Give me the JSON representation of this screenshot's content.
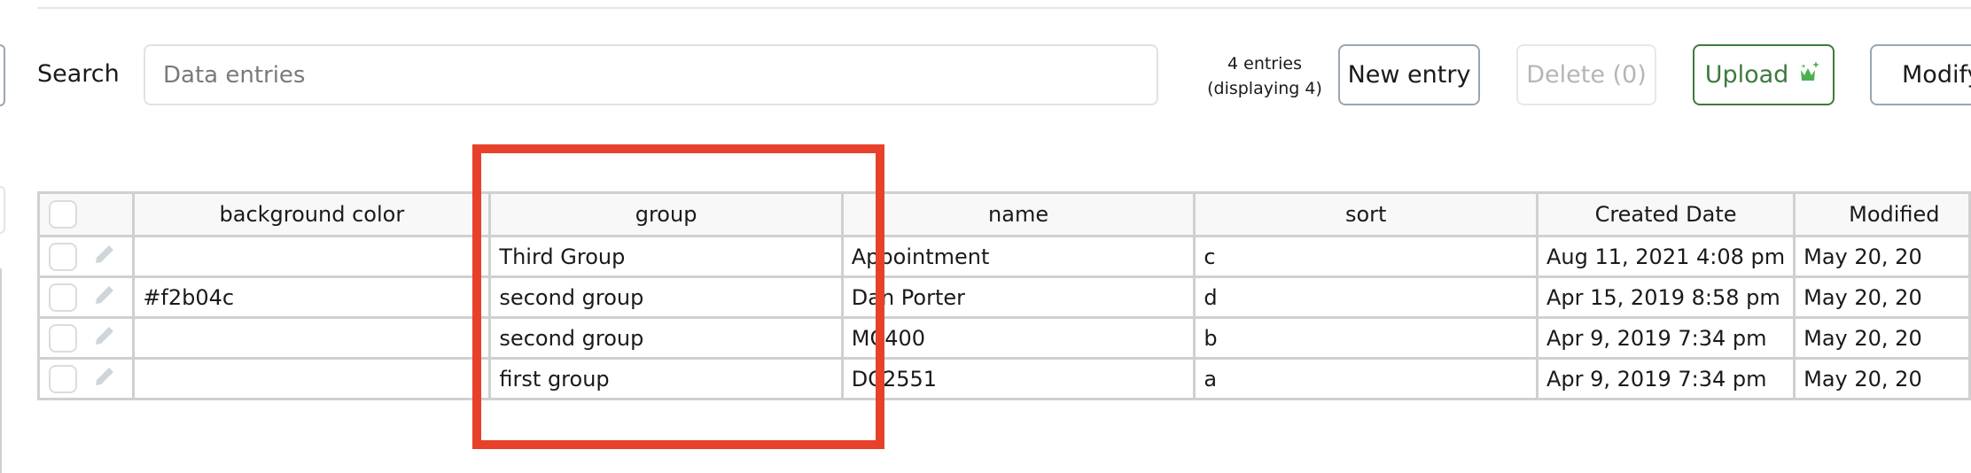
{
  "search": {
    "label": "Search",
    "placeholder": "Data entries",
    "value": ""
  },
  "toolbar": {
    "entries_count": "4 entries (displaying 4)",
    "new_entry_label": "New entry",
    "delete_label": "Delete (0)",
    "upload_label": "Upload",
    "upload_icon": "crown-sparkle-icon",
    "modify_label": "Modify"
  },
  "colors": {
    "accent_green": "#3d7a3d",
    "upload_icon": "#4caf50",
    "highlight": "#e8412b"
  },
  "table": {
    "columns": [
      "background color",
      "group",
      "name",
      "sort",
      "Created Date",
      "Modified"
    ],
    "rows": [
      {
        "background_color": "",
        "group": "Third Group",
        "name": "Appointment",
        "sort": "c",
        "created": "Aug 11, 2021 4:08 pm",
        "modified": "May 20, 20"
      },
      {
        "background_color": "#f2b04c",
        "group": "second group",
        "name": "Dan Porter",
        "sort": "d",
        "created": "Apr 15, 2019 8:58 pm",
        "modified": "May 20, 20"
      },
      {
        "background_color": "",
        "group": "second group",
        "name": "MC400",
        "sort": "b",
        "created": "Apr 9, 2019 7:34 pm",
        "modified": "May 20, 20"
      },
      {
        "background_color": "",
        "group": "first group",
        "name": "DC2551",
        "sort": "a",
        "created": "Apr 9, 2019 7:34 pm",
        "modified": "May 20, 20"
      }
    ]
  },
  "annotation": {
    "highlighted_column": "group"
  }
}
